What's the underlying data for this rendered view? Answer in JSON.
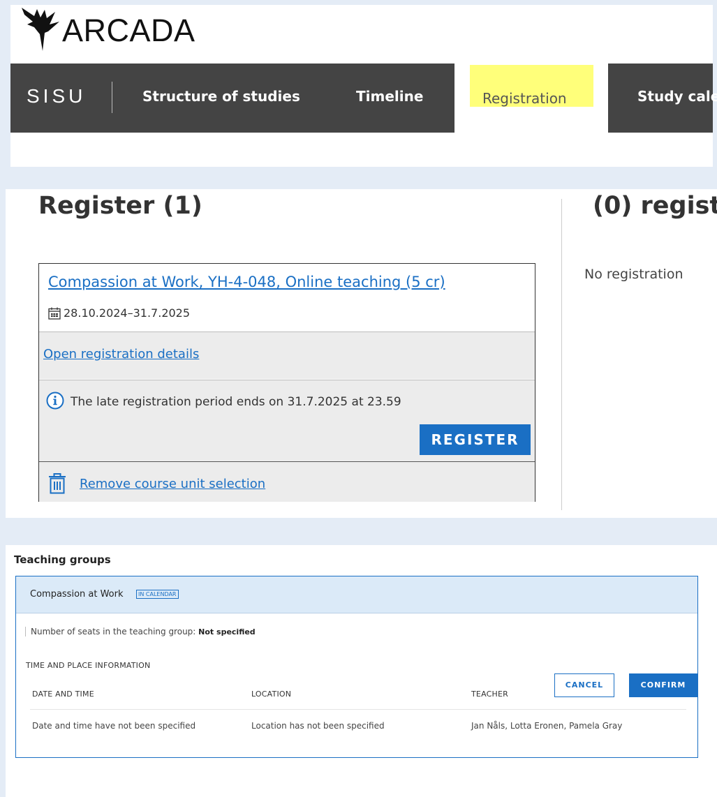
{
  "header": {
    "logo_text": "ARCADA",
    "app_name": "SISU",
    "nav": {
      "structure": "Structure of studies",
      "timeline": "Timeline",
      "registration": "Registration",
      "calendar": "Study cale"
    }
  },
  "registration": {
    "register_heading": "Register (1)",
    "registered_heading": "(0) regist",
    "no_registrations": "No registration",
    "card": {
      "course_link": "Compassion at Work, YH-4-048, Online teaching (5 cr)",
      "date_range": "28.10.2024–31.7.2025",
      "open_details": "Open registration details",
      "late_notice": "The late registration period ends on 31.7.2025 at 23.59",
      "register_button": "REGISTER",
      "remove_link": "Remove course unit selection"
    }
  },
  "teaching_groups": {
    "title": "Teaching groups",
    "group_name": "Compassion at Work",
    "badge": "IN CALENDAR",
    "seats_label": "Number of seats in the teaching group:",
    "seats_value": "Not specified",
    "time_place_title": "TIME AND PLACE INFORMATION",
    "columns": [
      "DATE AND TIME",
      "LOCATION",
      "TEACHER"
    ],
    "row": [
      "Date and time have not been specified",
      "Location has not been specified",
      "Jan Nåls, Lotta Eronen, Pamela Gray"
    ],
    "cancel_button": "CANCEL",
    "confirm_button": "CONFIRM"
  },
  "colors": {
    "background": "#e4ecf6",
    "navbar": "#444444",
    "highlight": "#ffff7a",
    "accent": "#1a6fc4"
  }
}
